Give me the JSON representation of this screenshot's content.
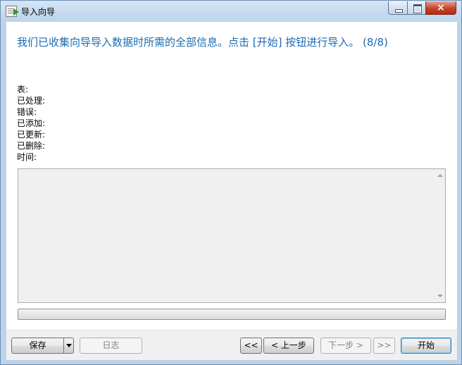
{
  "window": {
    "title": "导入向导",
    "close_label": "×"
  },
  "heading": "我们已收集向导导入数据时所需的全部信息。点击 [开始] 按钮进行导入。 (8/8)",
  "stats": [
    "表:",
    "已处理:",
    "错误:",
    "已添加:",
    "已更新:",
    "已删除:",
    "时间:"
  ],
  "progress": 0,
  "buttons": {
    "save": "保存",
    "log": "日志",
    "first": "<<",
    "prev": "< 上一步",
    "next": "下一步 >",
    "last": ">>",
    "start": "开始"
  }
}
